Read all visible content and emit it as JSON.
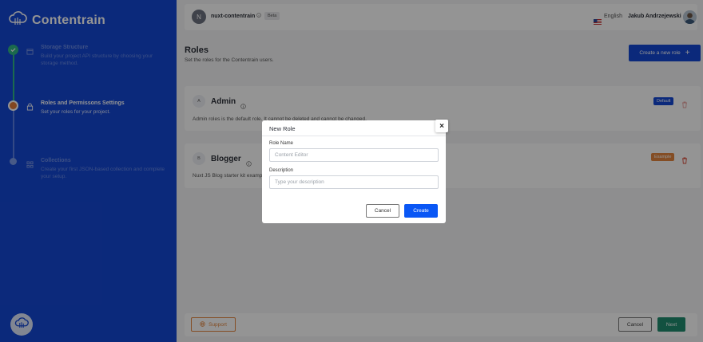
{
  "brand": {
    "name": "Contentrain"
  },
  "steps": [
    {
      "title": "Storage Structure",
      "desc": "Build your project API structure by choosing your storage method.",
      "state": "done"
    },
    {
      "title": "Roles and Permissons Settings",
      "desc": "Set your roles for your project.",
      "state": "active"
    },
    {
      "title": "Collections",
      "desc": "Create your first JSON-based collection and complete your setup.",
      "state": "pending"
    }
  ],
  "topbar": {
    "project_initial": "N",
    "project_name": "nuxt-contentrain",
    "beta": "Beta",
    "language": "English",
    "user_name": "Jakub Andrzejewski"
  },
  "page": {
    "title": "Roles",
    "subtitle": "Set the roles for the Contentrain users.",
    "create_button": "Create a new role",
    "create_icon": "+"
  },
  "roles": [
    {
      "letter": "A",
      "name": "Admin",
      "desc": "Admin roles is the default role. It cannot be deleted and cannot be changed.",
      "tag": "Default",
      "tag_color": "#1447d4"
    },
    {
      "letter": "B",
      "name": "Blogger",
      "desc": "Nuxt JS Blog starter kit example role.",
      "tag": "Example",
      "tag_color": "#e3863f"
    }
  ],
  "footer": {
    "support": "Support",
    "cancel": "Cancel",
    "next": "Next"
  },
  "modal": {
    "title": "New Role",
    "close": "×",
    "role_name_label": "Role Name",
    "role_name_placeholder": "Content Editor",
    "description_label": "Description",
    "description_placeholder": "Type your description",
    "cancel": "Cancel",
    "create": "Create"
  },
  "colors": {
    "sidebar": "#1447d4",
    "accent": "#0a57f5",
    "success": "#2fb786",
    "warning": "#e3863f"
  }
}
